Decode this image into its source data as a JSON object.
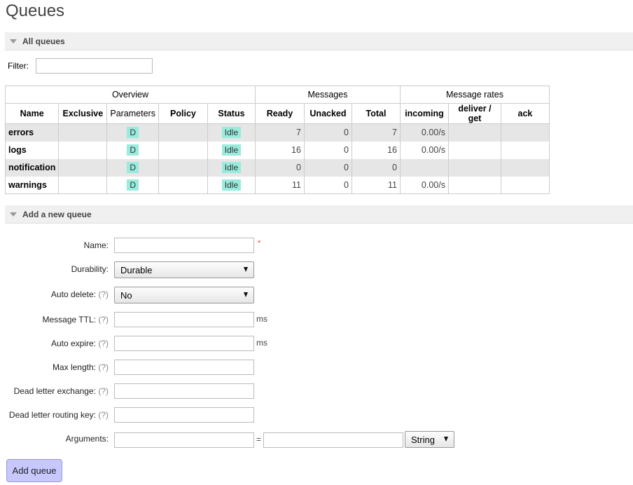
{
  "page": {
    "title": "Queues"
  },
  "all_queues": {
    "header": "All queues",
    "filter_label": "Filter:",
    "filter_value": "",
    "group_headers": [
      "Overview",
      "Messages",
      "Message rates"
    ],
    "columns": [
      "Name",
      "Exclusive",
      "Parameters",
      "Policy",
      "Status",
      "Ready",
      "Unacked",
      "Total",
      "incoming",
      "deliver / get",
      "ack"
    ],
    "rows": [
      {
        "name": "errors",
        "exclusive": "",
        "param": "D",
        "policy": "",
        "status": "Idle",
        "ready": "7",
        "unacked": "0",
        "total": "7",
        "incoming": "0.00/s",
        "deliver": "",
        "ack": ""
      },
      {
        "name": "logs",
        "exclusive": "",
        "param": "D",
        "policy": "",
        "status": "Idle",
        "ready": "16",
        "unacked": "0",
        "total": "16",
        "incoming": "0.00/s",
        "deliver": "",
        "ack": ""
      },
      {
        "name": "notification",
        "exclusive": "",
        "param": "D",
        "policy": "",
        "status": "Idle",
        "ready": "0",
        "unacked": "0",
        "total": "0",
        "incoming": "",
        "deliver": "",
        "ack": ""
      },
      {
        "name": "warnings",
        "exclusive": "",
        "param": "D",
        "policy": "",
        "status": "Idle",
        "ready": "11",
        "unacked": "0",
        "total": "11",
        "incoming": "0.00/s",
        "deliver": "",
        "ack": ""
      }
    ]
  },
  "add_queue": {
    "header": "Add a new queue",
    "required_mark": "*",
    "help_mark": "(?)",
    "fields": {
      "name": {
        "label": "Name:",
        "value": ""
      },
      "durability": {
        "label": "Durability:",
        "value": "Durable"
      },
      "auto_delete": {
        "label": "Auto delete:",
        "value": "No"
      },
      "message_ttl": {
        "label": "Message TTL:",
        "value": "",
        "unit": "ms"
      },
      "auto_expire": {
        "label": "Auto expire:",
        "value": "",
        "unit": "ms"
      },
      "max_length": {
        "label": "Max length:",
        "value": ""
      },
      "dead_letter_exchange": {
        "label": "Dead letter exchange:",
        "value": ""
      },
      "dead_letter_routing_key": {
        "label": "Dead letter routing key:",
        "value": ""
      },
      "arguments": {
        "label": "Arguments:",
        "key": "",
        "equals": "=",
        "value": "",
        "type": "String"
      }
    },
    "submit_label": "Add queue"
  }
}
